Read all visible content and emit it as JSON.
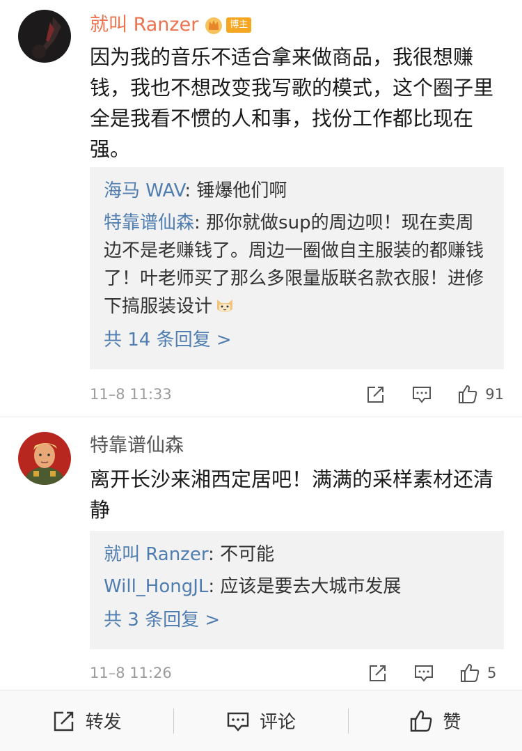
{
  "comments": [
    {
      "author": "就叫 Ranzer",
      "badge": "博主",
      "text": "因为我的音乐不适合拿来做商品，我很想赚钱，我也不想改变我写歌的模式，这个圈子里全是我看不惯的人和事，找份工作都比现在强。",
      "replies": [
        {
          "name": "海马 WAV",
          "text": ": 锤爆他们啊"
        },
        {
          "name": "特靠谱仙森",
          "text": ": 那你就做sup的周边呗！现在卖周边不是老赚钱了。周边一圈做自主服装的都赚钱了！叶老师买了那么多限量版联名款衣服！进修下搞服装设计"
        }
      ],
      "more": "共 14 条回复 >",
      "time": "11–8 11:33",
      "likes": "91"
    },
    {
      "author": "特靠谱仙森",
      "text": "离开长沙来湘西定居吧！满满的采样素材还清静",
      "replies": [
        {
          "name": "就叫 Ranzer",
          "text": ": 不可能"
        },
        {
          "name": "Will_HongJL",
          "text": ": 应该是要去大城市发展"
        }
      ],
      "more": "共 3 条回复 >",
      "time": "11–8 11:26",
      "likes": "5"
    }
  ],
  "bottom_bar": {
    "repost": "转发",
    "comment": "评论",
    "like": "赞"
  },
  "colors": {
    "author_orange": "#eb7350",
    "link_blue": "#507daf",
    "reply_bg": "#f2f2f2",
    "badge": "#f5a623"
  }
}
